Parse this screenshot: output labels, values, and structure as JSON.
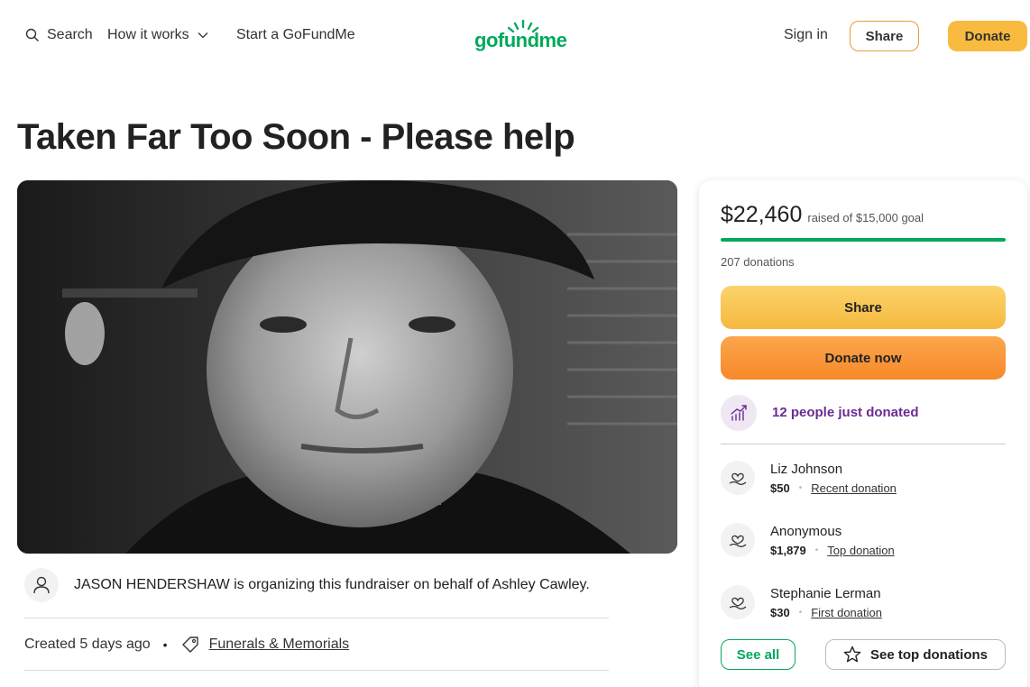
{
  "header": {
    "search_label": "Search",
    "how_it_works_label": "How it works",
    "start_label": "Start a GoFundMe",
    "logo_text": "gofundme",
    "sign_in_label": "Sign in",
    "share_label": "Share",
    "donate_label": "Donate"
  },
  "campaign": {
    "title": "Taken Far Too Soon - Please help",
    "organizer_text": "JASON HENDERSHAW is organizing this fundraiser on behalf of Ashley Cawley.",
    "created": "Created 5 days ago",
    "separator": "•",
    "category": "Funerals & Memorials"
  },
  "sidebar": {
    "raised_amount": "$22,460",
    "raised_goal": "raised of $15,000 goal",
    "progress_fraction": 1.0,
    "donations_count": "207 donations",
    "share_label": "Share",
    "donate_now_label": "Donate now",
    "trend_text": "12 people just donated",
    "donors": [
      {
        "name": "Liz Johnson",
        "amount": "$50",
        "tag": "Recent donation"
      },
      {
        "name": "Anonymous",
        "amount": "$1,879",
        "tag": "Top donation"
      },
      {
        "name": "Stephanie Lerman",
        "amount": "$30",
        "tag": "First donation"
      }
    ],
    "donor_separator": "•",
    "see_all_label": "See all",
    "see_top_label": "See top donations"
  },
  "colors": {
    "brand_green": "#02a95c",
    "donate_yellow": "#f9bb3f",
    "donate_orange": "#f7892a",
    "trend_purple": "#6b2c91"
  }
}
